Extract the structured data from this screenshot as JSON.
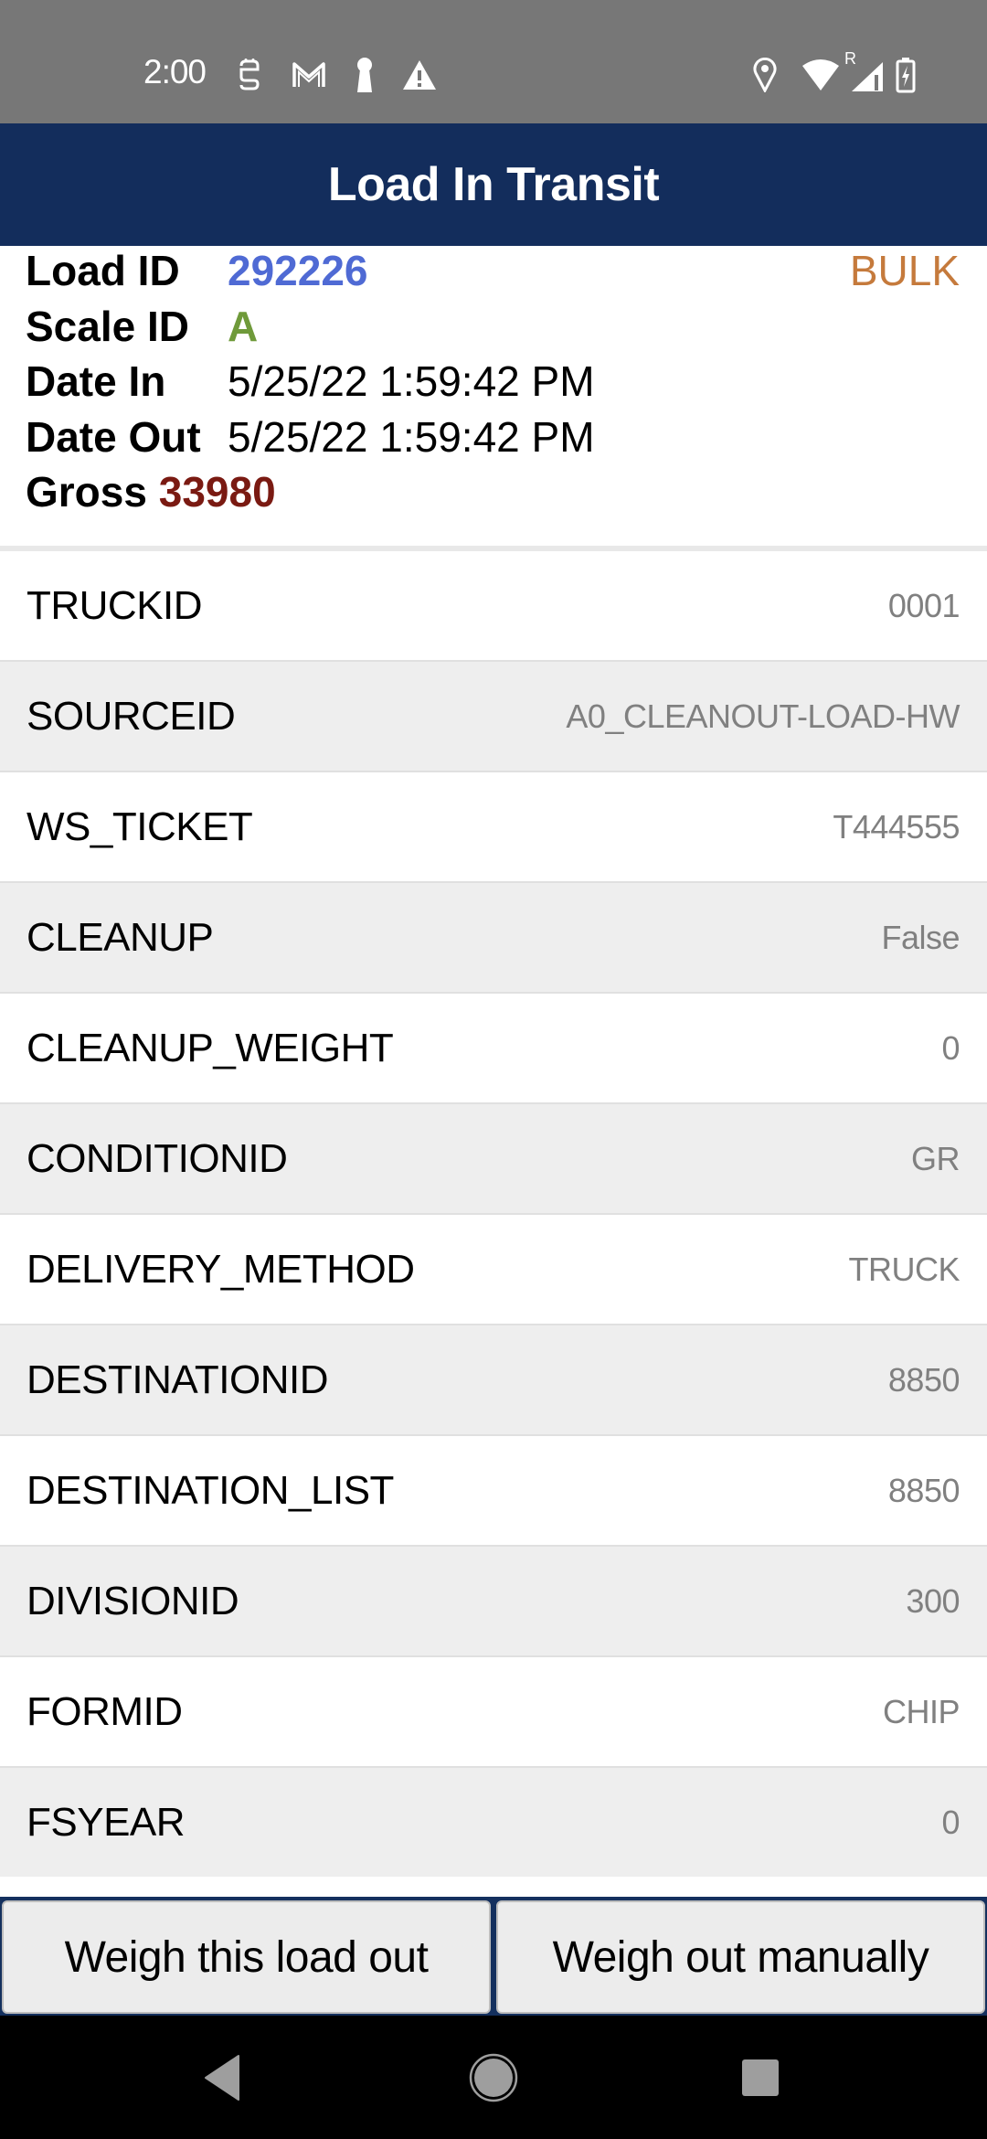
{
  "status_bar": {
    "time": "2:00",
    "left_icons": [
      "sim-toolkit-icon",
      "gmail-icon",
      "keyhole-icon",
      "warning-icon"
    ],
    "right_icons": [
      "location-icon",
      "wifi-icon",
      "signal-roaming-icon",
      "battery-charging-icon"
    ],
    "roaming_label": "R"
  },
  "header": {
    "title": "Load In Transit"
  },
  "load_info": {
    "load_id_label": "Load ID",
    "load_id": "292226",
    "type": "BULK",
    "scale_id_label": "Scale ID",
    "scale_id": "A",
    "date_in_label": "Date In",
    "date_in": "5/25/22 1:59:42 PM",
    "date_out_label": "Date Out",
    "date_out": "5/25/22 1:59:42 PM",
    "gross_label": "Gross",
    "gross": "33980"
  },
  "colors": {
    "header_bg": "#132d5c",
    "load_id": "#4f6ad4",
    "scale_id": "#6f9a3a",
    "gross": "#7a1a12",
    "type": "#c57a3c"
  },
  "fields": [
    {
      "key": "TRUCKID",
      "value": "0001"
    },
    {
      "key": "SOURCEID",
      "value": "A0_CLEANOUT-LOAD-HW"
    },
    {
      "key": "WS_TICKET",
      "value": "T444555"
    },
    {
      "key": "CLEANUP",
      "value": "False"
    },
    {
      "key": "CLEANUP_WEIGHT",
      "value": "0"
    },
    {
      "key": "CONDITIONID",
      "value": "GR"
    },
    {
      "key": "DELIVERY_METHOD",
      "value": "TRUCK"
    },
    {
      "key": "DESTINATIONID",
      "value": "8850"
    },
    {
      "key": "DESTINATION_LIST",
      "value": "8850"
    },
    {
      "key": "DIVISIONID",
      "value": "300"
    },
    {
      "key": "FORMID",
      "value": "CHIP"
    },
    {
      "key": "FSYEAR",
      "value": "0"
    }
  ],
  "actions": {
    "weigh_load_out": "Weigh this load out",
    "weigh_out_manually": "Weigh out manually"
  },
  "nav": {
    "back": "back-icon",
    "home": "home-icon",
    "recents": "recents-icon"
  }
}
